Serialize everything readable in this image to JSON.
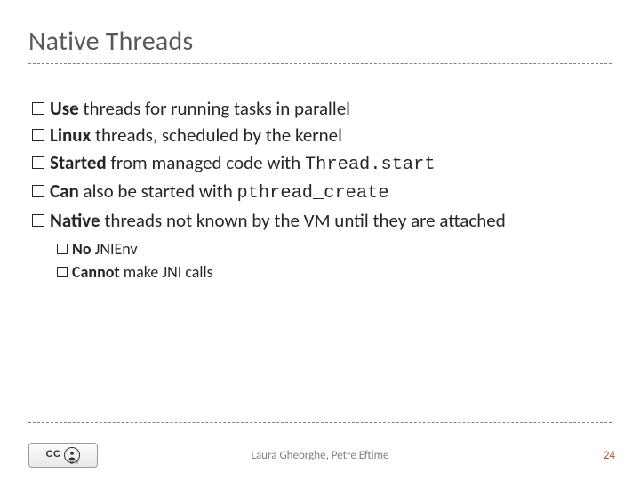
{
  "title": "Native Threads",
  "bullets": [
    {
      "pre": "Use",
      "rest": " threads for running tasks in parallel"
    },
    {
      "pre": "Linux",
      "rest": " threads, scheduled by the kernel"
    },
    {
      "pre": "Started",
      "rest": " from managed code with ",
      "code": "Thread.start"
    },
    {
      "pre": "Can",
      "rest": " also be started with ",
      "code": "pthread_create"
    },
    {
      "pre": "Native",
      "rest": " threads not known by the VM until they are attached"
    }
  ],
  "subbullets": [
    {
      "pre": "No",
      "rest": " JNIEnv"
    },
    {
      "pre": "Cannot",
      "rest": " make JNI calls"
    }
  ],
  "footer": {
    "authors": "Laura Gheorghe, Petre Eftime",
    "page": "24",
    "cc_label": "CC",
    "cc_by": "BY",
    "cc_person_glyph": "➀"
  }
}
